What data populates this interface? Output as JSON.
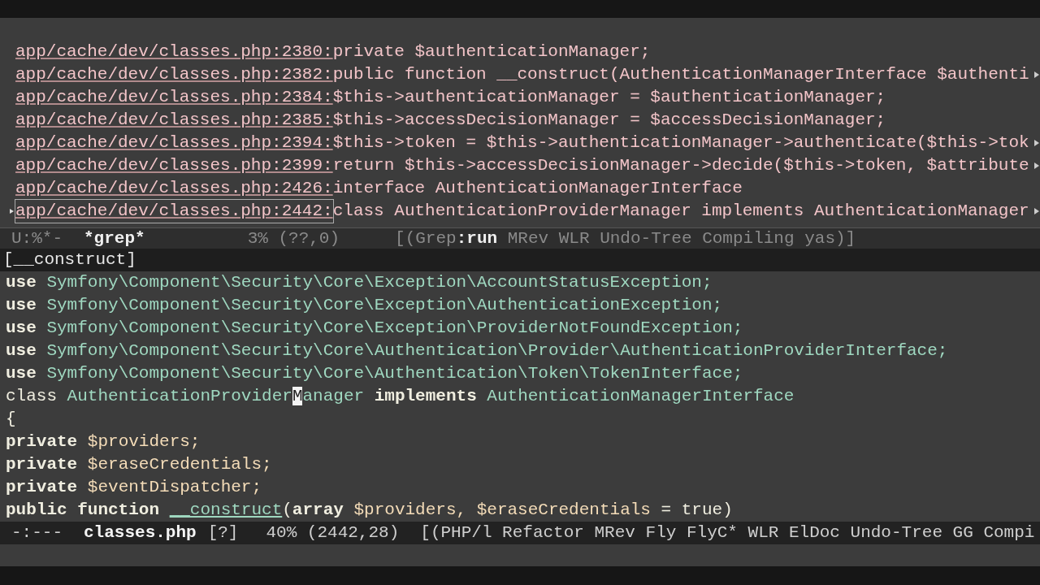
{
  "grep_buffer": {
    "rows": [
      {
        "location": "app/cache/dev/classes.php:2380:",
        "text": "private $authenticationManager;",
        "truncated": false,
        "current": false
      },
      {
        "location": "app/cache/dev/classes.php:2382:",
        "text": "public function __construct(AuthenticationManagerInterface $authenti",
        "truncated": true,
        "current": false
      },
      {
        "location": "app/cache/dev/classes.php:2384:",
        "text": "$this->authenticationManager = $authenticationManager;",
        "truncated": false,
        "current": false
      },
      {
        "location": "app/cache/dev/classes.php:2385:",
        "text": "$this->accessDecisionManager = $accessDecisionManager;",
        "truncated": false,
        "current": false
      },
      {
        "location": "app/cache/dev/classes.php:2394:",
        "text": "$this->token = $this->authenticationManager->authenticate($this->tok",
        "truncated": true,
        "current": false
      },
      {
        "location": "app/cache/dev/classes.php:2399:",
        "text": "return $this->accessDecisionManager->decide($this->token, $attribute",
        "truncated": true,
        "current": false
      },
      {
        "location": "app/cache/dev/classes.php:2426:",
        "text": "interface AuthenticationManagerInterface",
        "truncated": false,
        "current": false
      },
      {
        "location": "app/cache/dev/classes.php:2442:",
        "text": "class AuthenticationProviderManager implements AuthenticationManager",
        "truncated": true,
        "current": true
      }
    ],
    "mode_line": {
      "status": "U:%*-",
      "buffer_name": "*grep*",
      "position": "3% (??,0)",
      "modes": "[(Grep**:run** MRev WLR Undo-Tree Compiling yas)]"
    }
  },
  "header_line": "[__construct]",
  "code_buffer": {
    "lines": [
      [
        {
          "text": "use",
          "kind": "keyword"
        },
        {
          "text": " Symfony\\Component\\Security\\Core\\Exception\\AccountStatusException;",
          "kind": "type"
        }
      ],
      [
        {
          "text": "use",
          "kind": "keyword"
        },
        {
          "text": " Symfony\\Component\\Security\\Core\\Exception\\AuthenticationException;",
          "kind": "type"
        }
      ],
      [
        {
          "text": "use",
          "kind": "keyword"
        },
        {
          "text": " Symfony\\Component\\Security\\Core\\Exception\\ProviderNotFoundException;",
          "kind": "type"
        }
      ],
      [
        {
          "text": "use",
          "kind": "keyword"
        },
        {
          "text": " Symfony\\Component\\Security\\Core\\Authentication\\Provider\\AuthenticationProviderInterface;",
          "kind": "type"
        }
      ],
      [
        {
          "text": "use",
          "kind": "keyword"
        },
        {
          "text": " Symfony\\Component\\Security\\Core\\Authentication\\Token\\TokenInterface;",
          "kind": "type"
        }
      ],
      [
        {
          "text": "class",
          "kind": "plain"
        },
        {
          "text": " AuthenticationProvider",
          "kind": "type"
        },
        {
          "text": "M",
          "kind": "cursor"
        },
        {
          "text": "anager",
          "kind": "type"
        },
        {
          "text": " implements",
          "kind": "keyword"
        },
        {
          "text": " AuthenticationManagerInterface",
          "kind": "type"
        }
      ],
      [
        {
          "text": "{",
          "kind": "plain"
        }
      ],
      [
        {
          "text": "private",
          "kind": "keyword"
        },
        {
          "text": " $providers;",
          "kind": "var"
        }
      ],
      [
        {
          "text": "private",
          "kind": "keyword"
        },
        {
          "text": " $eraseCredentials;",
          "kind": "var"
        }
      ],
      [
        {
          "text": "private",
          "kind": "keyword"
        },
        {
          "text": " $eventDispatcher;",
          "kind": "var"
        }
      ],
      [
        {
          "text": "public function",
          "kind": "keyword"
        },
        {
          "text": "__construct",
          "kind": "function"
        },
        {
          "text": "(",
          "kind": "plain"
        },
        {
          "text": "array",
          "kind": "keyword"
        },
        {
          "text": " $providers, $eraseCredentials",
          "kind": "var"
        },
        {
          "text": " = true)",
          "kind": "plain"
        }
      ]
    ],
    "mode_line": {
      "status": "-:---",
      "buffer_name": "classes.php",
      "flag": "[?]",
      "position": "40% (2442,28)",
      "modes": "[(PHP/l Refactor MRev Fly FlyC* WLR ElDoc Undo-Tree GG Compi"
    }
  }
}
